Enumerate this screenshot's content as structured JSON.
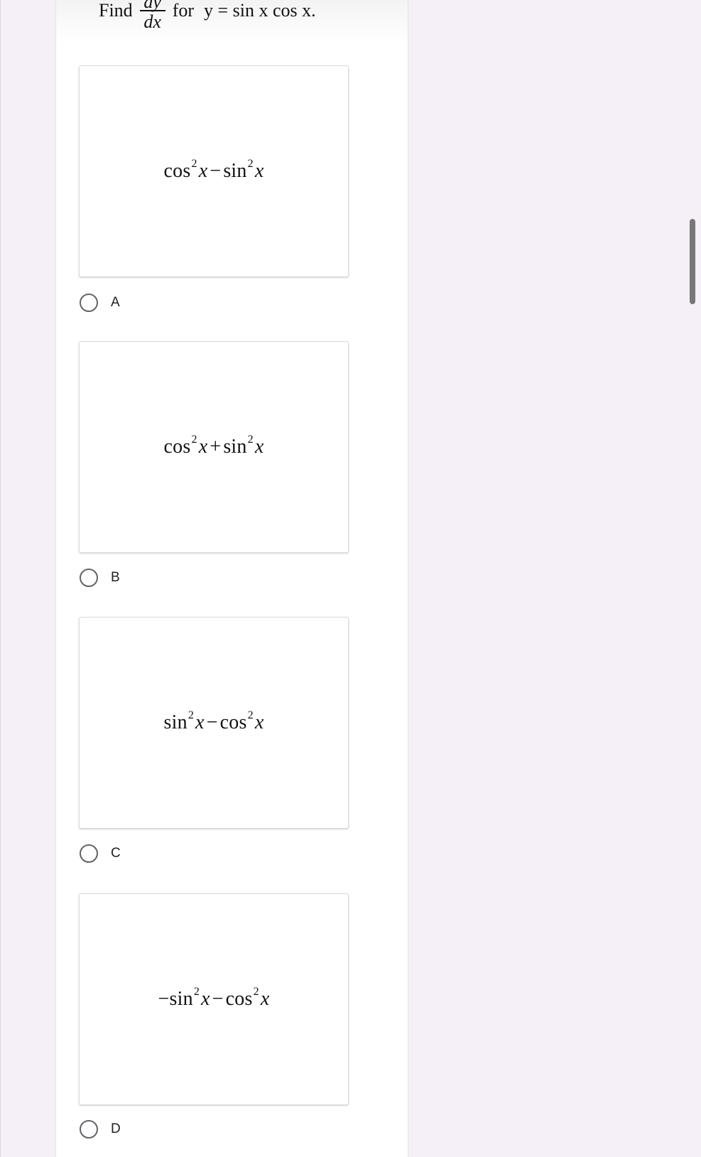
{
  "question": {
    "prefix": "Find",
    "fraction_numerator": "dy",
    "fraction_denominator": "dx",
    "connector": "for",
    "expression": "y = sin x cos x."
  },
  "options": [
    {
      "label": "A",
      "formula": {
        "f1": "cos",
        "e1": "2",
        "v1": "x",
        "op": "−",
        "f2": "sin",
        "e2": "2",
        "v2": "x",
        "lead": ""
      }
    },
    {
      "label": "B",
      "formula": {
        "f1": "cos",
        "e1": "2",
        "v1": "x",
        "op": "+",
        "f2": "sin",
        "e2": "2",
        "v2": "x",
        "lead": ""
      }
    },
    {
      "label": "C",
      "formula": {
        "f1": "sin",
        "e1": "2",
        "v1": "x",
        "op": "−",
        "f2": "cos",
        "e2": "2",
        "v2": "x",
        "lead": ""
      }
    },
    {
      "label": "D",
      "formula": {
        "f1": "sin",
        "e1": "2",
        "v1": "x",
        "op": "−",
        "f2": "cos",
        "e2": "2",
        "v2": "x",
        "lead": "−"
      }
    }
  ],
  "colors": {
    "page_background": "#f5f0f7",
    "card_background": "#ffffff",
    "radio_border": "#5f6368"
  }
}
